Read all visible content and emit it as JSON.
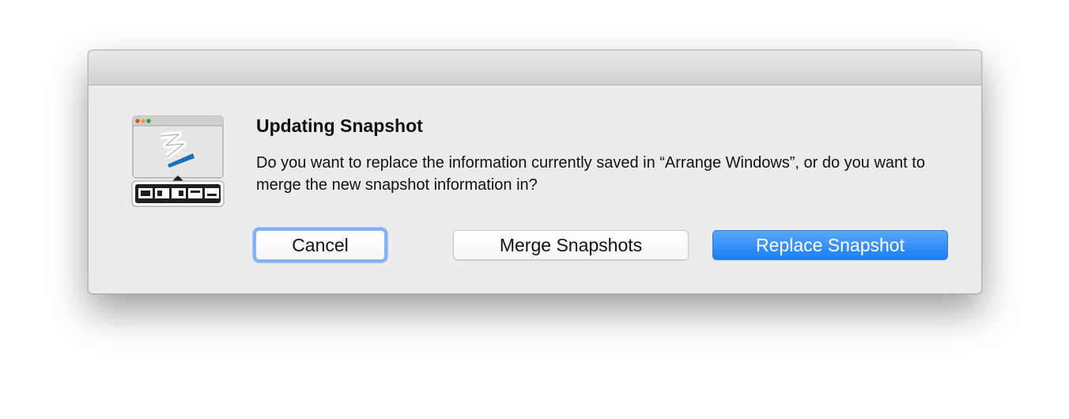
{
  "dialog": {
    "title": "Updating Snapshot",
    "message": "Do you want to replace the information currently saved in “Arrange Windows”, or do you want to merge the new snapshot information in?",
    "icon": "app-icon"
  },
  "buttons": {
    "cancel_label": "Cancel",
    "merge_label": "Merge Snapshots",
    "replace_label": "Replace Snapshot"
  },
  "colors": {
    "primary_button": "#1b7ef2",
    "focus_ring": "#7fb1f3",
    "dialog_background": "#ececec"
  }
}
